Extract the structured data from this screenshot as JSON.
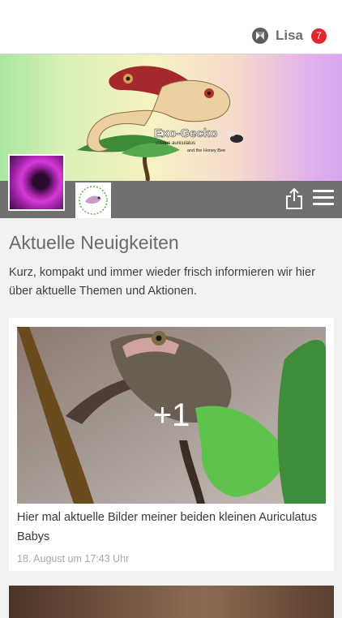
{
  "header": {
    "username": "Lisa",
    "notification_count": "7",
    "logo_icon": "app-logo-icon"
  },
  "cover": {
    "brand_title": "Exo-Gecko",
    "brand_line": "ciliatus  auriculatus",
    "brand_tagline": "and the Honey Bee"
  },
  "news": {
    "title": "Aktuelle Neuigkeiten",
    "description": "Kurz, kompakt und immer wieder frisch informieren wir hier über aktuelle Themen und Aktionen."
  },
  "posts": [
    {
      "more_images": "+1",
      "caption": "Hier mal aktuelle Bilder meiner beiden kleinen Auriculatus Babys",
      "date": "18. August um 17:43 Uhr"
    }
  ],
  "colors": {
    "badge": "#e1262c",
    "navbar": "#707070",
    "background": "#f2f2f2"
  }
}
